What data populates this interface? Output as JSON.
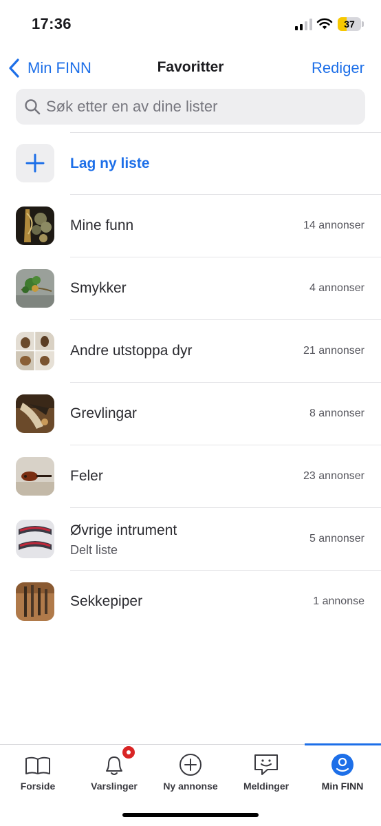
{
  "status_bar": {
    "time": "17:36",
    "battery_level": "37",
    "battery_fraction": 0.37,
    "signal_bars_active": 2,
    "signal_bars_total": 4
  },
  "nav": {
    "back_label": "Min FINN",
    "title": "Favoritter",
    "edit_label": "Rediger"
  },
  "search": {
    "placeholder": "Søk etter en av dine lister"
  },
  "new_list": {
    "label": "Lag ny liste"
  },
  "lists": [
    {
      "name": "Mine funn",
      "count": "14 annonser",
      "subtitle": ""
    },
    {
      "name": "Smykker",
      "count": "4 annonser",
      "subtitle": ""
    },
    {
      "name": "Andre utstoppa dyr",
      "count": "21 annonser",
      "subtitle": ""
    },
    {
      "name": "Grevlingar",
      "count": "8 annonser",
      "subtitle": ""
    },
    {
      "name": "Feler",
      "count": "23 annonser",
      "subtitle": ""
    },
    {
      "name": "Øvrige intrument",
      "count": "5 annonser",
      "subtitle": "Delt liste"
    },
    {
      "name": "Sekkepiper",
      "count": "1 annonse",
      "subtitle": ""
    }
  ],
  "tabs": [
    {
      "label": "Forside",
      "icon": "book-icon"
    },
    {
      "label": "Varslinger",
      "icon": "bell-icon"
    },
    {
      "label": "Ny annonse",
      "icon": "plus-circle-icon"
    },
    {
      "label": "Meldinger",
      "icon": "chat-icon"
    },
    {
      "label": "Min FINN",
      "icon": "profile-icon"
    }
  ],
  "colors": {
    "accent": "#1d6fe8",
    "badge": "#d92525",
    "battery": "#f7c800"
  }
}
